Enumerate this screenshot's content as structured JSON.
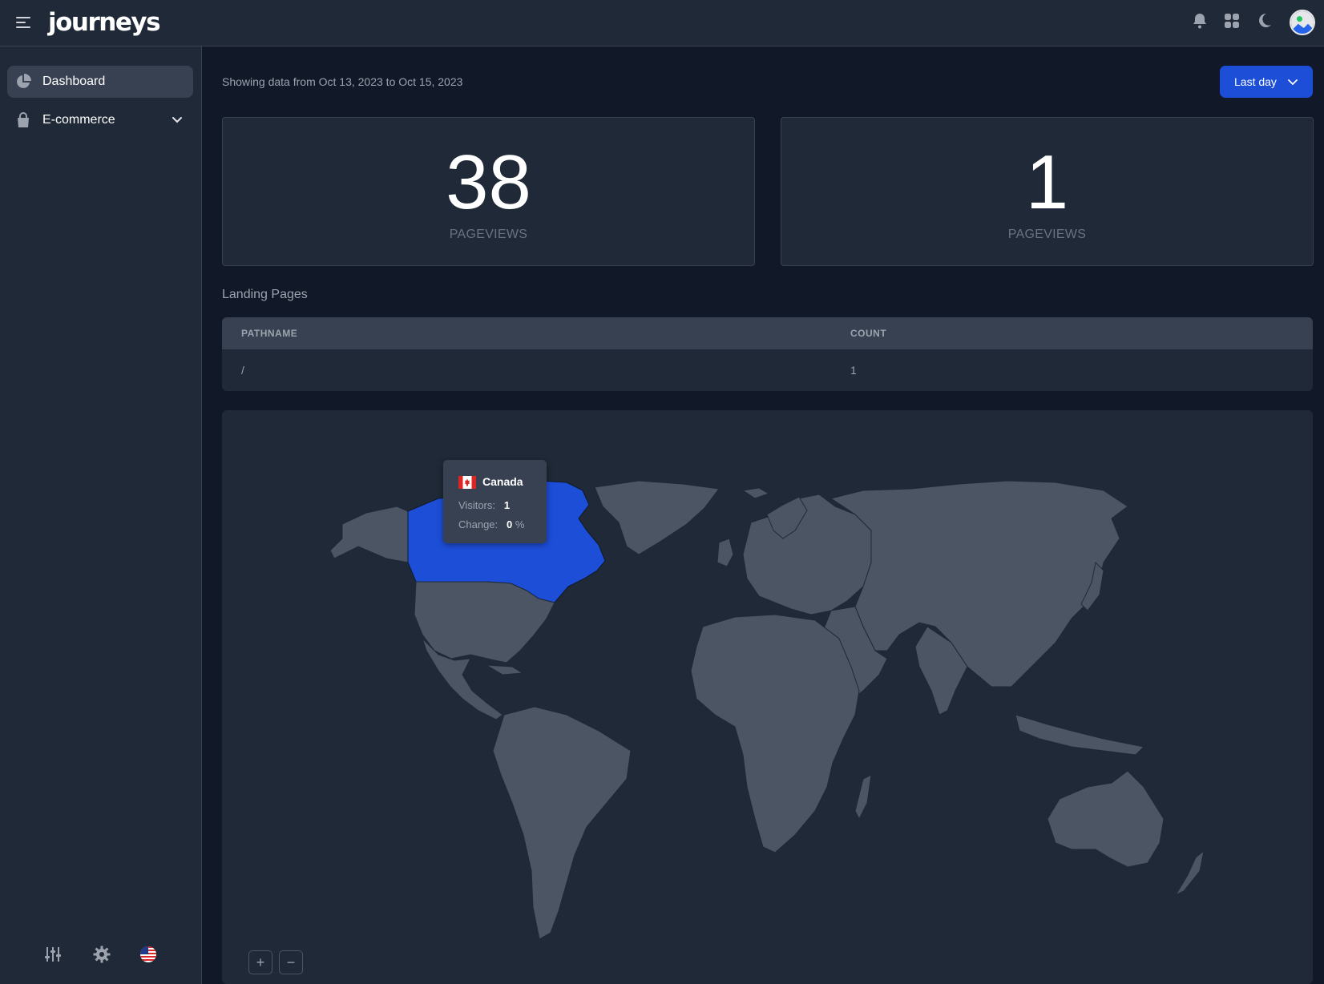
{
  "app": {
    "logo_text": "journeys"
  },
  "topbar": {
    "icons": [
      "menu-icon",
      "bell-icon",
      "apps-grid-icon",
      "moon-icon",
      "avatar"
    ]
  },
  "sidebar": {
    "items": [
      {
        "label": "Dashboard",
        "icon": "pie-chart-icon",
        "active": true
      },
      {
        "label": "E-commerce",
        "icon": "shopping-bag-icon",
        "active": false,
        "expandable": true
      }
    ],
    "bottom_icons": [
      "sliders-icon",
      "gear-icon",
      "us-flag-icon"
    ]
  },
  "main": {
    "range_text": "Showing data from  Oct 13, 2023 to Oct 15, 2023",
    "range_button_label": "Last day",
    "stats": [
      {
        "value": "38",
        "caption": "PAGEVIEWS"
      },
      {
        "value": "1",
        "caption": "PAGEVIEWS"
      }
    ],
    "landing_title": "Landing Pages",
    "table": {
      "columns": [
        "PATHNAME",
        "COUNT"
      ],
      "rows": [
        {
          "pathname": "/",
          "count": "1"
        }
      ]
    },
    "map": {
      "highlighted_country": "Canada",
      "tooltip": {
        "country": "Canada",
        "visitors_label": "Visitors:",
        "visitors_value": "1",
        "change_label": "Change:",
        "change_value": "0",
        "change_unit": "%"
      },
      "zoom_in": "+",
      "zoom_out": "−"
    }
  },
  "colors": {
    "background": "#111827",
    "panel": "#1f2937",
    "accent": "#1d4ed8",
    "land": "#4b5563"
  }
}
